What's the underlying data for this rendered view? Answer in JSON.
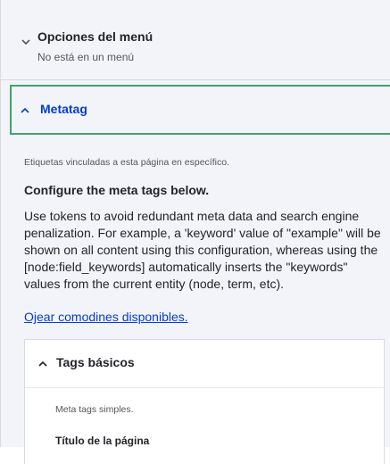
{
  "menu_section": {
    "title": "Opciones del menú",
    "subtitle": "No está en un menú",
    "icon": "chevron-down-icon"
  },
  "metatag": {
    "title": "Metatag",
    "icon": "chevron-up-icon",
    "description": "Etiquetas vinculadas a esta página en específico.",
    "configure_title": "Configure the meta tags below.",
    "configure_body": "Use tokens to avoid redundant meta data and search engine penalization. For example, a 'keyword' value of \"example\" will be shown on all content using this configuration, whereas using the [node:field_keywords] automatically inserts the \"keywords\" values from the current entity (node, term, etc).",
    "tokens_link": "Ojear comodines disponibles."
  },
  "basic_tags": {
    "title": "Tags básicos",
    "icon": "chevron-up-icon",
    "description": "Meta tags simples.",
    "page_title_label": "Título de la página"
  },
  "colors": {
    "focus_border": "#3fa56b",
    "link": "#003ecc",
    "panel_bg": "#f3f4f9"
  }
}
